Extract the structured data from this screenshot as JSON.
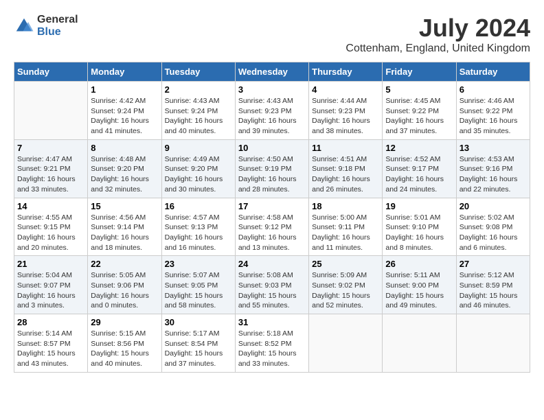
{
  "header": {
    "logo": {
      "general": "General",
      "blue": "Blue"
    },
    "title": "July 2024",
    "location": "Cottenham, England, United Kingdom"
  },
  "weekdays": [
    "Sunday",
    "Monday",
    "Tuesday",
    "Wednesday",
    "Thursday",
    "Friday",
    "Saturday"
  ],
  "weeks": [
    [
      {
        "day": "",
        "info": ""
      },
      {
        "day": "1",
        "info": "Sunrise: 4:42 AM\nSunset: 9:24 PM\nDaylight: 16 hours\nand 41 minutes."
      },
      {
        "day": "2",
        "info": "Sunrise: 4:43 AM\nSunset: 9:24 PM\nDaylight: 16 hours\nand 40 minutes."
      },
      {
        "day": "3",
        "info": "Sunrise: 4:43 AM\nSunset: 9:23 PM\nDaylight: 16 hours\nand 39 minutes."
      },
      {
        "day": "4",
        "info": "Sunrise: 4:44 AM\nSunset: 9:23 PM\nDaylight: 16 hours\nand 38 minutes."
      },
      {
        "day": "5",
        "info": "Sunrise: 4:45 AM\nSunset: 9:22 PM\nDaylight: 16 hours\nand 37 minutes."
      },
      {
        "day": "6",
        "info": "Sunrise: 4:46 AM\nSunset: 9:22 PM\nDaylight: 16 hours\nand 35 minutes."
      }
    ],
    [
      {
        "day": "7",
        "info": "Sunrise: 4:47 AM\nSunset: 9:21 PM\nDaylight: 16 hours\nand 33 minutes."
      },
      {
        "day": "8",
        "info": "Sunrise: 4:48 AM\nSunset: 9:20 PM\nDaylight: 16 hours\nand 32 minutes."
      },
      {
        "day": "9",
        "info": "Sunrise: 4:49 AM\nSunset: 9:20 PM\nDaylight: 16 hours\nand 30 minutes."
      },
      {
        "day": "10",
        "info": "Sunrise: 4:50 AM\nSunset: 9:19 PM\nDaylight: 16 hours\nand 28 minutes."
      },
      {
        "day": "11",
        "info": "Sunrise: 4:51 AM\nSunset: 9:18 PM\nDaylight: 16 hours\nand 26 minutes."
      },
      {
        "day": "12",
        "info": "Sunrise: 4:52 AM\nSunset: 9:17 PM\nDaylight: 16 hours\nand 24 minutes."
      },
      {
        "day": "13",
        "info": "Sunrise: 4:53 AM\nSunset: 9:16 PM\nDaylight: 16 hours\nand 22 minutes."
      }
    ],
    [
      {
        "day": "14",
        "info": "Sunrise: 4:55 AM\nSunset: 9:15 PM\nDaylight: 16 hours\nand 20 minutes."
      },
      {
        "day": "15",
        "info": "Sunrise: 4:56 AM\nSunset: 9:14 PM\nDaylight: 16 hours\nand 18 minutes."
      },
      {
        "day": "16",
        "info": "Sunrise: 4:57 AM\nSunset: 9:13 PM\nDaylight: 16 hours\nand 16 minutes."
      },
      {
        "day": "17",
        "info": "Sunrise: 4:58 AM\nSunset: 9:12 PM\nDaylight: 16 hours\nand 13 minutes."
      },
      {
        "day": "18",
        "info": "Sunrise: 5:00 AM\nSunset: 9:11 PM\nDaylight: 16 hours\nand 11 minutes."
      },
      {
        "day": "19",
        "info": "Sunrise: 5:01 AM\nSunset: 9:10 PM\nDaylight: 16 hours\nand 8 minutes."
      },
      {
        "day": "20",
        "info": "Sunrise: 5:02 AM\nSunset: 9:08 PM\nDaylight: 16 hours\nand 6 minutes."
      }
    ],
    [
      {
        "day": "21",
        "info": "Sunrise: 5:04 AM\nSunset: 9:07 PM\nDaylight: 16 hours\nand 3 minutes."
      },
      {
        "day": "22",
        "info": "Sunrise: 5:05 AM\nSunset: 9:06 PM\nDaylight: 16 hours\nand 0 minutes."
      },
      {
        "day": "23",
        "info": "Sunrise: 5:07 AM\nSunset: 9:05 PM\nDaylight: 15 hours\nand 58 minutes."
      },
      {
        "day": "24",
        "info": "Sunrise: 5:08 AM\nSunset: 9:03 PM\nDaylight: 15 hours\nand 55 minutes."
      },
      {
        "day": "25",
        "info": "Sunrise: 5:09 AM\nSunset: 9:02 PM\nDaylight: 15 hours\nand 52 minutes."
      },
      {
        "day": "26",
        "info": "Sunrise: 5:11 AM\nSunset: 9:00 PM\nDaylight: 15 hours\nand 49 minutes."
      },
      {
        "day": "27",
        "info": "Sunrise: 5:12 AM\nSunset: 8:59 PM\nDaylight: 15 hours\nand 46 minutes."
      }
    ],
    [
      {
        "day": "28",
        "info": "Sunrise: 5:14 AM\nSunset: 8:57 PM\nDaylight: 15 hours\nand 43 minutes."
      },
      {
        "day": "29",
        "info": "Sunrise: 5:15 AM\nSunset: 8:56 PM\nDaylight: 15 hours\nand 40 minutes."
      },
      {
        "day": "30",
        "info": "Sunrise: 5:17 AM\nSunset: 8:54 PM\nDaylight: 15 hours\nand 37 minutes."
      },
      {
        "day": "31",
        "info": "Sunrise: 5:18 AM\nSunset: 8:52 PM\nDaylight: 15 hours\nand 33 minutes."
      },
      {
        "day": "",
        "info": ""
      },
      {
        "day": "",
        "info": ""
      },
      {
        "day": "",
        "info": ""
      }
    ]
  ]
}
